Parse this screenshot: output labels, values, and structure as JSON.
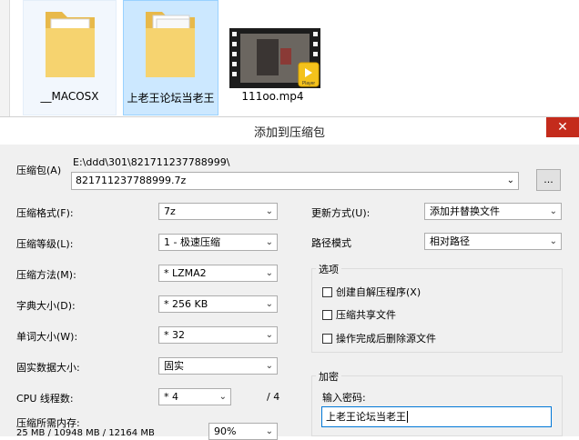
{
  "explorer": {
    "files": [
      {
        "name": "__MACOSX"
      },
      {
        "name": "上老王论坛当老王"
      },
      {
        "name": "111oo.mp4",
        "badge": "Player"
      }
    ]
  },
  "dialog": {
    "title": "添加到压缩包",
    "close_glyph": "✕",
    "archive": {
      "label": "压缩包(A)",
      "path": "E:\\ddd\\301\\821711237788999\\",
      "filename": "821711237788999.7z",
      "browse_label": "..."
    },
    "left": {
      "format": {
        "label": "压缩格式(F):",
        "value": "7z"
      },
      "level": {
        "label": "压缩等级(L):",
        "value": "1 - 极速压缩"
      },
      "method": {
        "label": "压缩方法(M):",
        "value": "* LZMA2"
      },
      "dict": {
        "label": "字典大小(D):",
        "value": "* 256 KB"
      },
      "word": {
        "label": "单词大小(W):",
        "value": "* 32"
      },
      "solid": {
        "label": "固实数据大小:",
        "value": "固实"
      },
      "cpu": {
        "label": "CPU 线程数:",
        "value": "* 4",
        "total": "/ 4"
      },
      "memory": {
        "label": "压缩所需内存:",
        "detail": "25 MB / 10948 MB / 12164 MB",
        "percent": "90%"
      }
    },
    "right": {
      "update": {
        "label": "更新方式(U):",
        "value": "添加并替换文件"
      },
      "path_mode": {
        "label": "路径模式",
        "value": "相对路径"
      },
      "options": {
        "title": "选项",
        "items": [
          "创建自解压程序(X)",
          "压缩共享文件",
          "操作完成后删除源文件"
        ]
      },
      "encryption": {
        "title": "加密",
        "password_label": "输入密码:",
        "password_value": "上老王论坛当老王"
      }
    },
    "arrow_glyph": "⌄"
  },
  "colors": {
    "accent": "#cce8ff",
    "close": "#c42b1c",
    "folder": "#f6d36f"
  }
}
